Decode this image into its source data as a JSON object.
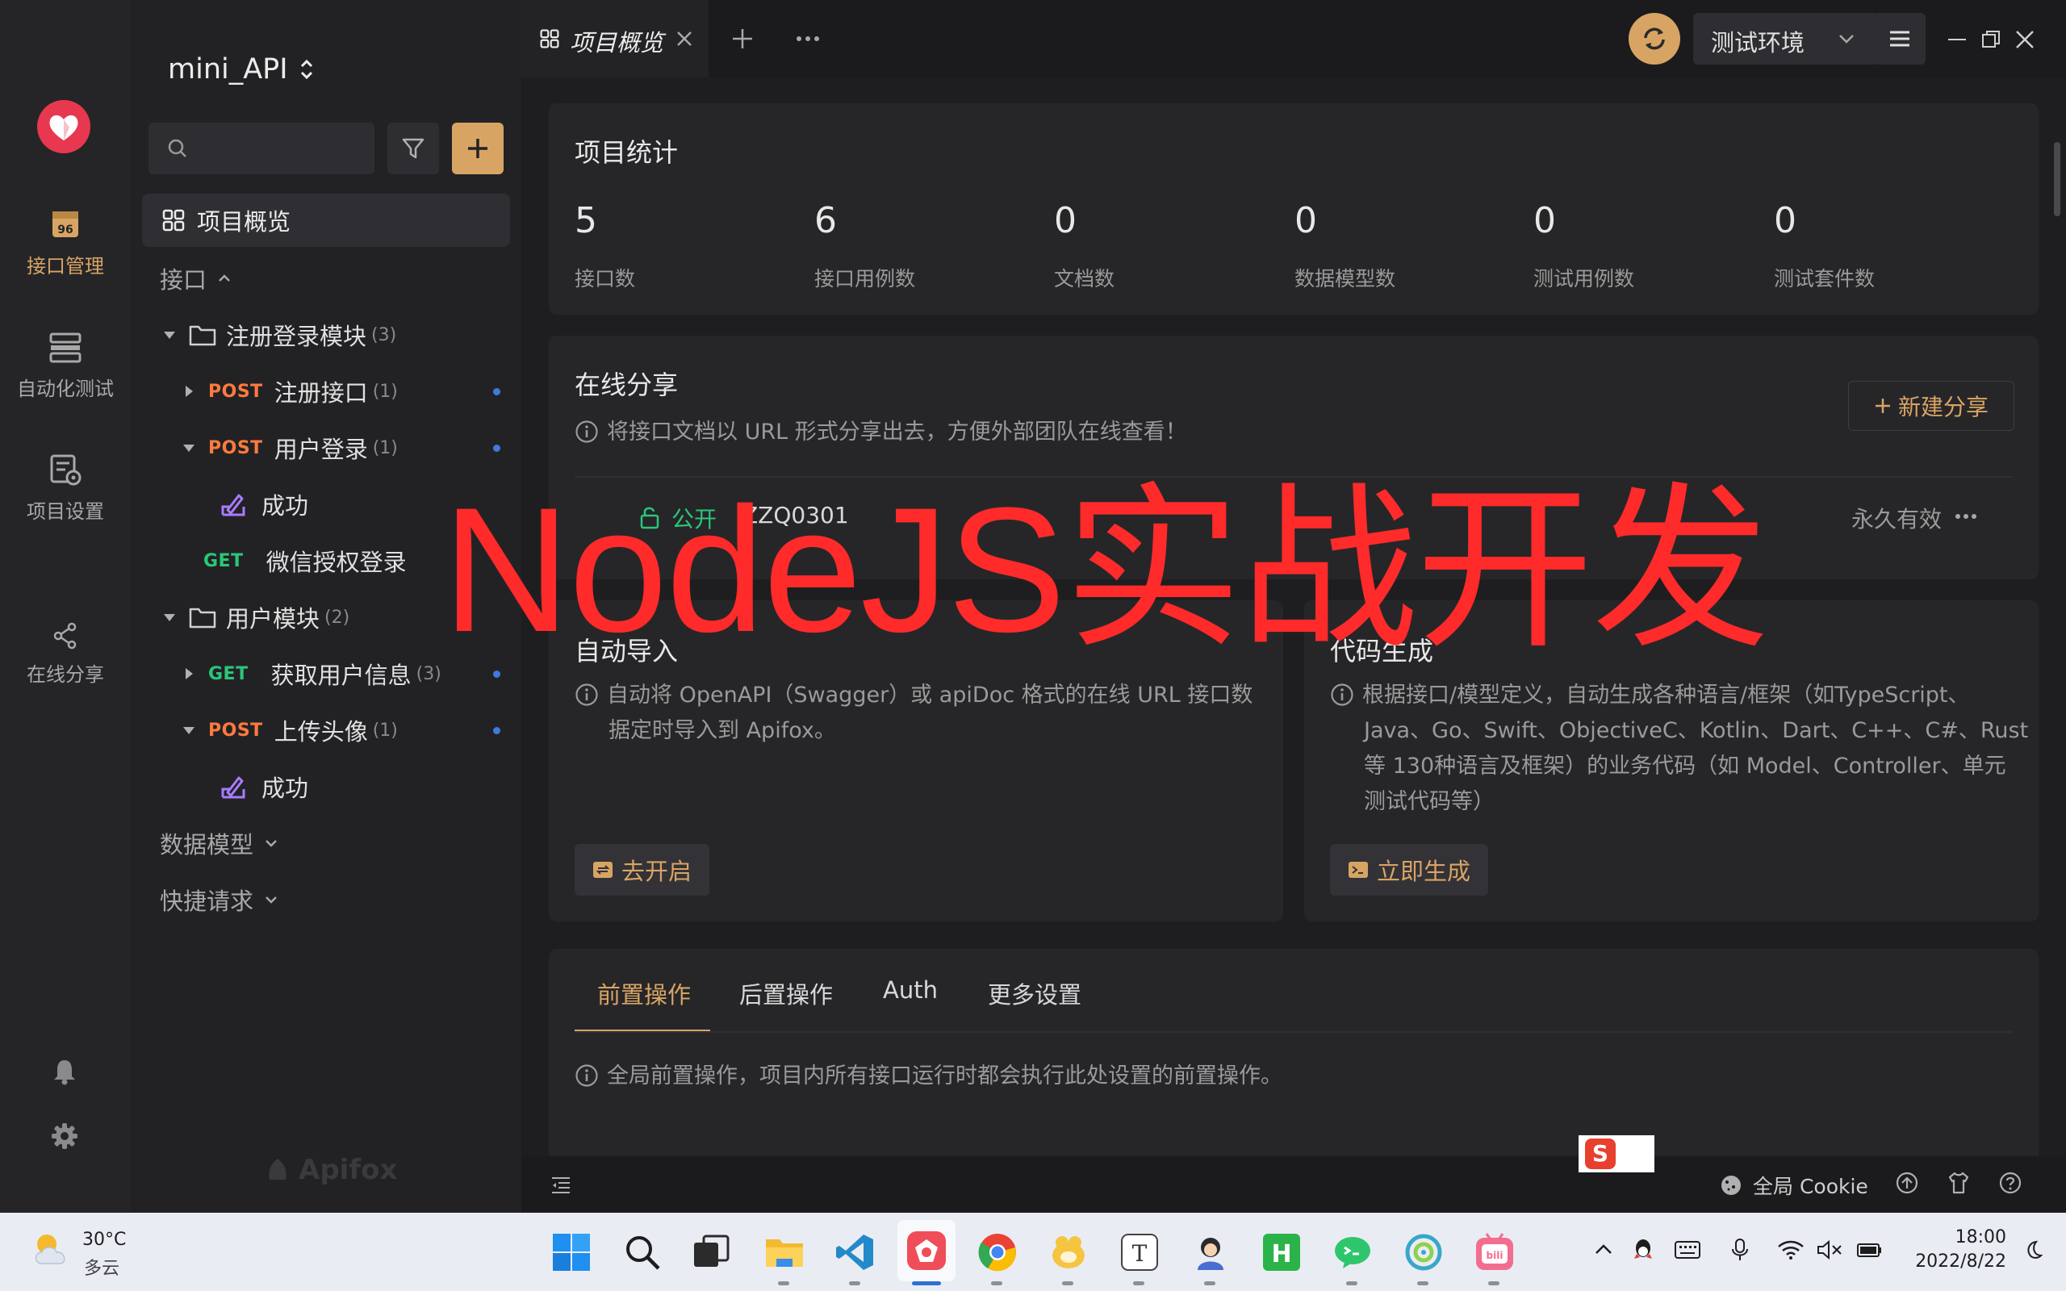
{
  "project": {
    "name": "mini_API"
  },
  "rail": {
    "items": [
      {
        "label": "接口管理",
        "icon": "api-manage-icon",
        "active": true
      },
      {
        "label": "自动化测试",
        "icon": "automation-icon"
      },
      {
        "label": "项目设置",
        "icon": "project-settings-icon"
      },
      {
        "label": "在线分享",
        "icon": "share-icon"
      }
    ]
  },
  "sidebar": {
    "search_placeholder": "",
    "overview_label": "项目概览",
    "api_section_label": "接口",
    "tree": [
      {
        "type": "folder",
        "label": "注册登录模块",
        "count": "(3)"
      },
      {
        "type": "api",
        "method": "POST",
        "label": "注册接口",
        "count": "(1)"
      },
      {
        "type": "api",
        "method": "POST",
        "label": "用户登录",
        "count": "(1)"
      },
      {
        "type": "case",
        "label": "成功"
      },
      {
        "type": "api",
        "method": "GET",
        "label": "微信授权登录",
        "count": ""
      },
      {
        "type": "folder",
        "label": "用户模块",
        "count": "(2)"
      },
      {
        "type": "api",
        "method": "GET",
        "label": "获取用户信息",
        "count": "(3)"
      },
      {
        "type": "api",
        "method": "POST",
        "label": "上传头像",
        "count": "(1)"
      },
      {
        "type": "case",
        "label": "成功"
      }
    ],
    "data_model_label": "数据模型",
    "quick_request_label": "快捷请求",
    "brand": "Apifox"
  },
  "topbar": {
    "active_tab": "项目概览",
    "environment": "测试环境"
  },
  "stats": {
    "title": "项目统计",
    "items": [
      {
        "value": "5",
        "label": "接口数"
      },
      {
        "value": "6",
        "label": "接口用例数"
      },
      {
        "value": "0",
        "label": "文档数"
      },
      {
        "value": "0",
        "label": "数据模型数"
      },
      {
        "value": "0",
        "label": "测试用例数"
      },
      {
        "value": "0",
        "label": "测试套件数"
      }
    ]
  },
  "share": {
    "title": "在线分享",
    "desc": "将接口文档以 URL 形式分享出去，方便外部团队在线查看！",
    "new_button": "新建分享",
    "row": {
      "visibility": "公开",
      "name": "ZZQ0301",
      "validity": "永久有效"
    }
  },
  "auto_import": {
    "title": "自动导入",
    "desc_line1": "自动将 OpenAPI（Swagger）或 apiDoc 格式的在线 URL 接口数",
    "desc_line2": "据定时导入到 Apifox。",
    "button": "去开启"
  },
  "code_gen": {
    "title": "代码生成",
    "desc_line1": "根据接口/模型定义，自动生成各种语言/框架（如TypeScript、",
    "desc_line2": "Java、Go、Swift、ObjectiveC、Kotlin、Dart、C++、C#、Rust",
    "desc_line3": "等 130种语言及框架）的业务代码（如 Model、Controller、单元",
    "desc_line4": "测试代码等）",
    "button": "立即生成"
  },
  "settings_tabs": {
    "tabs": [
      "前置操作",
      "后置操作",
      "Auth",
      "更多设置"
    ],
    "desc": "全局前置操作，项目内所有接口运行时都会执行此处设置的前置操作。"
  },
  "statusbar": {
    "cookie_label": "全局 Cookie"
  },
  "overlay_text": "NodeJS实战开发",
  "taskbar": {
    "weather_temp": "30°C",
    "weather_desc": "多云",
    "time": "18:00",
    "date": "2022/8/22"
  },
  "colors": {
    "accent": "#d8a464",
    "post": "#ff7a3d",
    "get": "#2ac779",
    "overlay": "#ff2a2a"
  }
}
